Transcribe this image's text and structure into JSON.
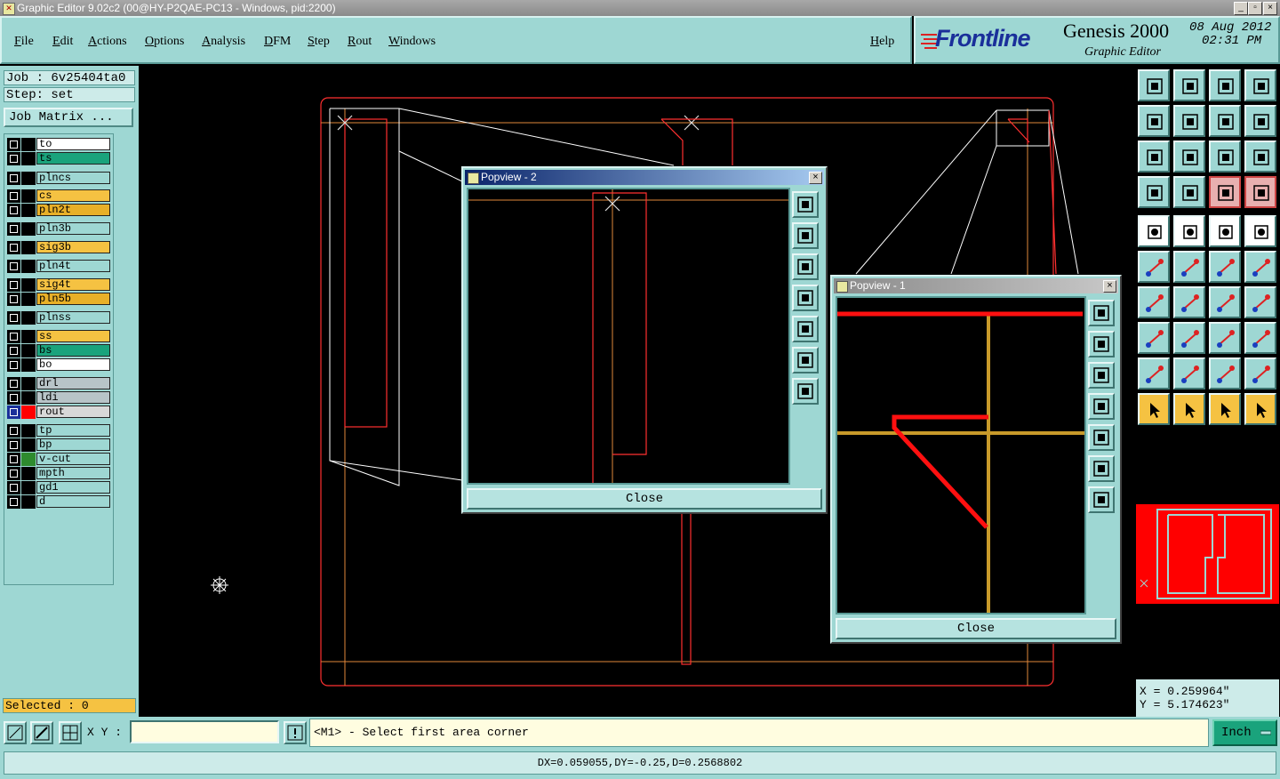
{
  "window": {
    "title": "Graphic Editor 9.02c2 (00@HY-P2QAE-PC13 - Windows, pid:2200)",
    "controls": [
      "_",
      "▫",
      "×"
    ]
  },
  "menu": [
    "File",
    "Edit",
    "Actions",
    "Options",
    "Analysis",
    "DFM",
    "Step",
    "Rout",
    "Windows"
  ],
  "help": "Help",
  "brand": {
    "logo": "Frontline",
    "product": "Genesis 2000",
    "subtitle": "Graphic Editor",
    "date": "08 Aug 2012",
    "time": "02:31 PM"
  },
  "job": {
    "job": "Job : 6v25404ta0",
    "step": "Step: set",
    "matrix_button": "Job Matrix ..."
  },
  "layers": [
    {
      "name": "to",
      "color": "#ffffff",
      "side": ""
    },
    {
      "name": "ts",
      "color": "#1aa37c",
      "side": ""
    },
    {
      "name": "plncs",
      "color": "#9ed7d3",
      "side": ""
    },
    {
      "name": "cs",
      "color": "#f5c242",
      "side": ""
    },
    {
      "name": "pln2t",
      "color": "#e8b028",
      "side": ""
    },
    {
      "name": "pln3b",
      "color": "#9ed7d3",
      "side": ""
    },
    {
      "name": "sig3b",
      "color": "#f5c242",
      "side": ""
    },
    {
      "name": "pln4t",
      "color": "#9ed7d3",
      "side": ""
    },
    {
      "name": "sig4t",
      "color": "#f5c242",
      "side": ""
    },
    {
      "name": "pln5b",
      "color": "#e8b028",
      "side": ""
    },
    {
      "name": "plnss",
      "color": "#9ed7d3",
      "side": ""
    },
    {
      "name": "ss",
      "color": "#f5c242",
      "side": ""
    },
    {
      "name": "bs",
      "color": "#1aa37c",
      "side": ""
    },
    {
      "name": "bo",
      "color": "#ffffff",
      "side": ""
    },
    {
      "name": "drl",
      "color": "#b8c4c8",
      "side": ""
    },
    {
      "name": "ldi",
      "color": "#b8c4c8",
      "side": ""
    },
    {
      "name": "rout",
      "color": "#d8d8d8",
      "side": "#ff0000"
    },
    {
      "name": "tp",
      "color": "#9ed7d3",
      "side": ""
    },
    {
      "name": "bp",
      "color": "#9ed7d3",
      "side": ""
    },
    {
      "name": "v-cut",
      "color": "#9ed7d3",
      "side": "#2e8b2e"
    },
    {
      "name": "mpth",
      "color": "#9ed7d3",
      "side": ""
    },
    {
      "name": "gd1",
      "color": "#9ed7d3",
      "side": ""
    },
    {
      "name": "d",
      "color": "#9ed7d3",
      "side": ""
    }
  ],
  "selected": "Selected : 0",
  "popview2": {
    "title": "Popview - 2",
    "close": "Close"
  },
  "popview1": {
    "title": "Popview - 1",
    "close": "Close"
  },
  "coords": {
    "x": "X = 0.259964\"",
    "y": "Y = 5.174623\""
  },
  "cmd": {
    "xy_label": "X Y :",
    "xy_value": "",
    "prompt": "<M1> - Select first area corner",
    "units": "Inch"
  },
  "status": "DX=0.059055,DY=-0.25,D=0.2568802",
  "colors": {
    "panel": "#9ed7d3",
    "accent": "#f5c242",
    "rout": "#ff0000"
  }
}
